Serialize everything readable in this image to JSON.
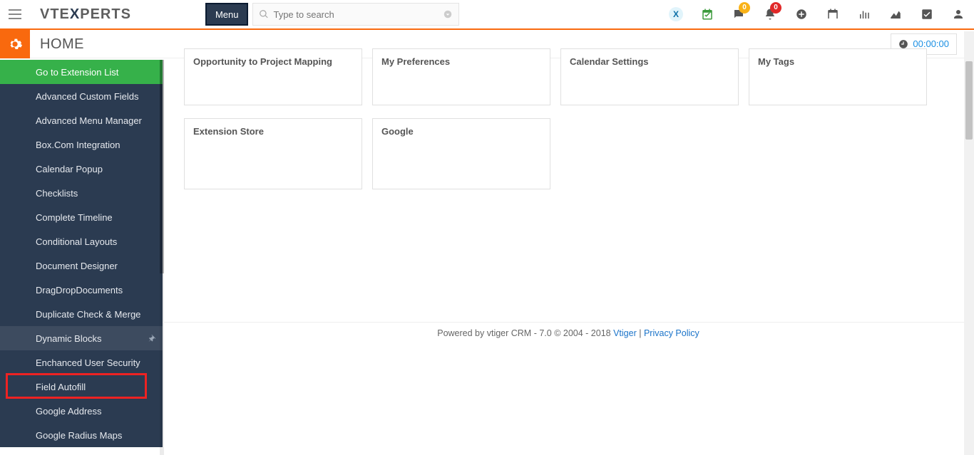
{
  "header": {
    "menu_label": "Menu",
    "search_placeholder": "Type to search"
  },
  "badges": {
    "chat": "0",
    "bell": "0"
  },
  "page": {
    "title": "HOME",
    "timer": "00:00:00"
  },
  "sidebar": {
    "items": [
      "Go to Extension List",
      "Advanced Custom Fields",
      "Advanced Menu Manager",
      "Box.Com Integration",
      "Calendar Popup",
      "Checklists",
      "Complete Timeline",
      "Conditional Layouts",
      "Document Designer",
      "DragDropDocuments",
      "Duplicate Check & Merge",
      "Dynamic Blocks",
      "Enchanced User Security",
      "Field Autofill",
      "Google Address",
      "Google Radius Maps"
    ]
  },
  "cards": {
    "row1": [
      "Opportunity to Project Mapping",
      "My Preferences",
      "Calendar Settings",
      "My Tags"
    ],
    "row2": [
      "Extension Store",
      "Google"
    ]
  },
  "footer": {
    "prefix": "Powered by ",
    "app": "vtiger CRM - 7.0",
    "copyright": "  © 2004 - 2018  ",
    "brand": "Vtiger",
    "sep": " |  ",
    "privacy": "Privacy Policy"
  }
}
